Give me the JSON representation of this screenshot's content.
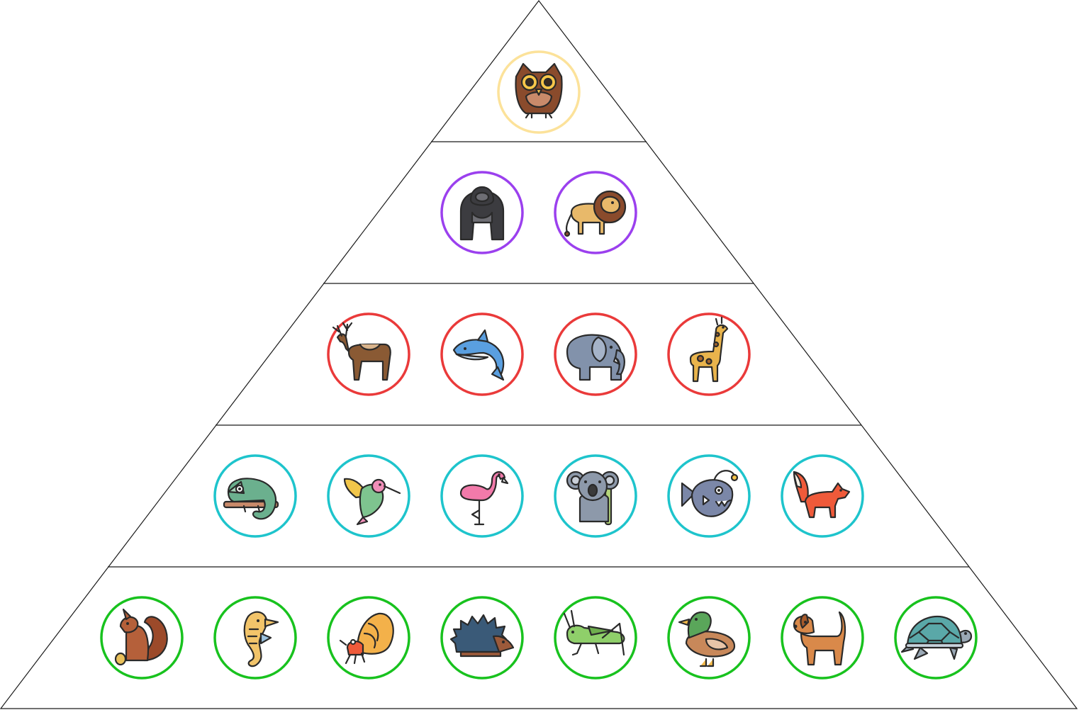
{
  "diagram": {
    "type": "pyramid",
    "tiers": [
      {
        "ring_color": "#fce29a",
        "animals": [
          {
            "icon": "owl-icon"
          }
        ]
      },
      {
        "ring_color": "#9b40ee",
        "animals": [
          {
            "icon": "gorilla-icon"
          },
          {
            "icon": "lion-icon"
          }
        ]
      },
      {
        "ring_color": "#ea3a3a",
        "animals": [
          {
            "icon": "deer-icon"
          },
          {
            "icon": "dolphin-icon"
          },
          {
            "icon": "elephant-icon"
          },
          {
            "icon": "giraffe-icon"
          }
        ]
      },
      {
        "ring_color": "#1ec4cc",
        "animals": [
          {
            "icon": "chameleon-icon"
          },
          {
            "icon": "hummingbird-icon"
          },
          {
            "icon": "flamingo-icon"
          },
          {
            "icon": "koala-icon"
          },
          {
            "icon": "anglerfish-icon"
          },
          {
            "icon": "fox-icon"
          }
        ]
      },
      {
        "ring_color": "#18c21e",
        "animals": [
          {
            "icon": "squirrel-icon"
          },
          {
            "icon": "seahorse-icon"
          },
          {
            "icon": "hermit-crab-icon"
          },
          {
            "icon": "hedgehog-icon"
          },
          {
            "icon": "grasshopper-icon"
          },
          {
            "icon": "duck-icon"
          },
          {
            "icon": "dog-icon"
          },
          {
            "icon": "turtle-icon"
          }
        ]
      }
    ]
  }
}
